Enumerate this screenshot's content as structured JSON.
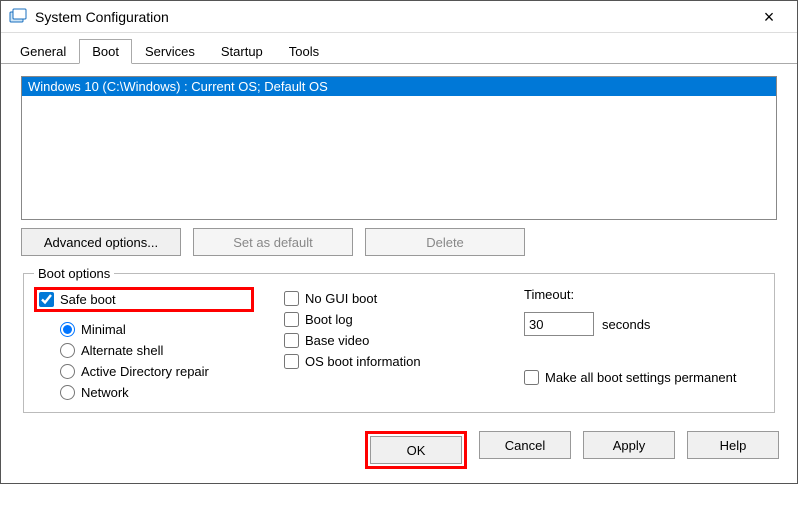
{
  "window": {
    "title": "System Configuration"
  },
  "tabs": {
    "general": "General",
    "boot": "Boot",
    "services": "Services",
    "startup": "Startup",
    "tools": "Tools"
  },
  "os_list": {
    "entry": "Windows 10 (C:\\Windows) : Current OS; Default OS"
  },
  "buttons": {
    "advanced": "Advanced options...",
    "set_default": "Set as default",
    "delete": "Delete"
  },
  "boot_options": {
    "legend": "Boot options",
    "safe_boot": "Safe boot",
    "minimal": "Minimal",
    "alt_shell": "Alternate shell",
    "ad_repair": "Active Directory repair",
    "network": "Network",
    "no_gui": "No GUI boot",
    "boot_log": "Boot log",
    "base_video": "Base video",
    "os_boot_info": "OS boot information"
  },
  "timeout": {
    "label": "Timeout:",
    "value": "30",
    "unit": "seconds"
  },
  "permanent": "Make all boot settings permanent",
  "footer": {
    "ok": "OK",
    "cancel": "Cancel",
    "apply": "Apply",
    "help": "Help"
  }
}
